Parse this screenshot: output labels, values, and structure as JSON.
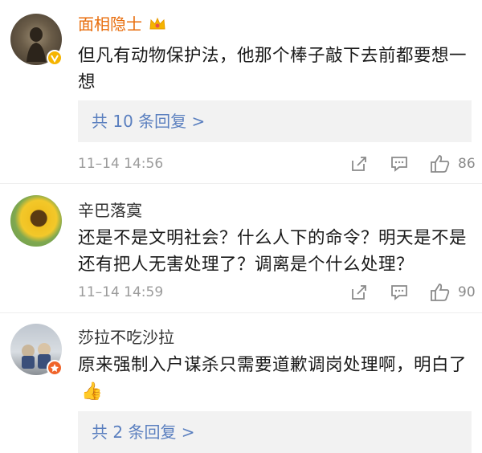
{
  "comments": [
    {
      "username": "面相隐士",
      "text": "但凡有动物保护法，他那个棒子敲下去前都要想一想",
      "replies_label": "共 10 条回复 >",
      "time": "11–14 14:56",
      "likes": "86",
      "badge": "vip-crown-icon",
      "verify": "yellow-v-icon"
    },
    {
      "username": "辛巴落寞",
      "text": "还是不是文明社会？什么人下的命令？明天是不是还有把人无害处理了？调离是个什么处理？",
      "time": "11–14 14:59",
      "likes": "90"
    },
    {
      "username": "莎拉不吃沙拉",
      "text": "原来强制入户谋杀只需要道歉调岗处理啊，明白了",
      "emoji": "👍",
      "replies_label": "共 2 条回复 >",
      "verify": "orange-star-icon"
    }
  ],
  "colors": {
    "username": "#e86d0c",
    "reply_link": "#5a7fbf",
    "meta": "#9b9b9b"
  }
}
